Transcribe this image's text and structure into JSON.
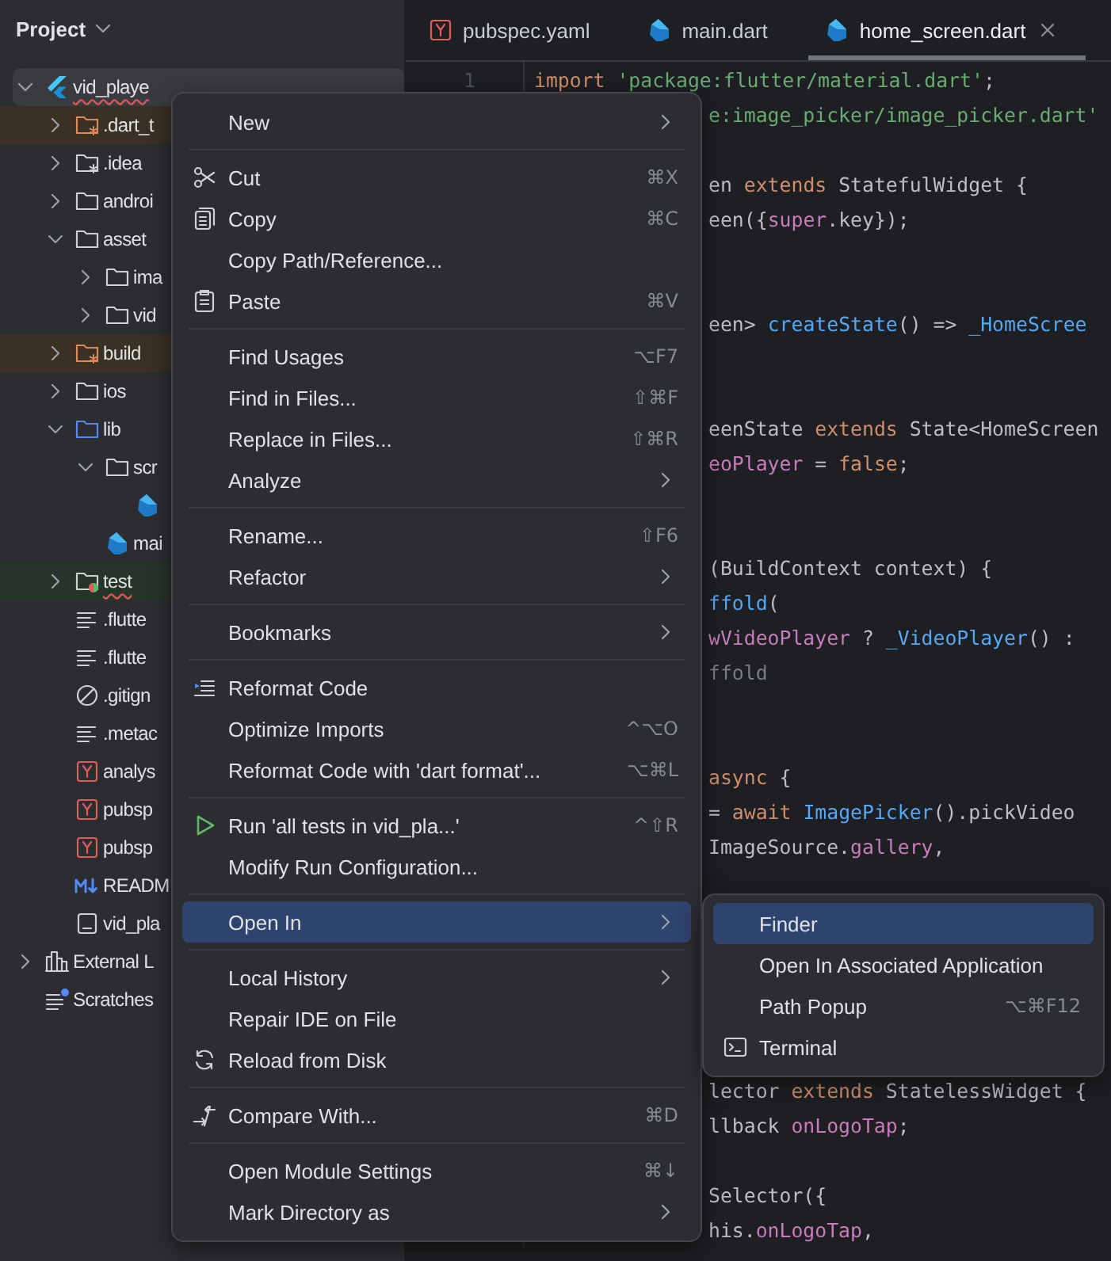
{
  "project_panel": {
    "title": "Project",
    "tree": [
      {
        "label": "vid_playe",
        "kind": "flutter",
        "expanded": true,
        "selected": true,
        "misspelled": true,
        "children": [
          {
            "label": ".dart_t",
            "kind": "folder-excluded",
            "expanded": false,
            "selected": false,
            "excluded": true
          },
          {
            "label": ".idea",
            "kind": "folder-config",
            "expanded": false,
            "selected": false
          },
          {
            "label": "androi",
            "kind": "folder",
            "expanded": false,
            "selected": false
          },
          {
            "label": "asset",
            "kind": "folder",
            "expanded": true,
            "selected": false,
            "children": [
              {
                "label": "ima",
                "kind": "folder",
                "expanded": false,
                "selected": false
              },
              {
                "label": "vid",
                "kind": "folder",
                "expanded": false,
                "selected": false
              }
            ]
          },
          {
            "label": "build",
            "kind": "folder-excluded",
            "expanded": false,
            "selected": false,
            "excluded": true
          },
          {
            "label": "ios",
            "kind": "folder",
            "expanded": false,
            "selected": false
          },
          {
            "label": "lib",
            "kind": "folder-source",
            "expanded": true,
            "selected": false,
            "children": [
              {
                "label": "scr",
                "kind": "folder",
                "expanded": true,
                "selected": false,
                "children": [
                  {
                    "kind": "dart",
                    "selected": false
                  }
                ]
              },
              {
                "label": "mai",
                "kind": "dart",
                "selected": false
              }
            ]
          },
          {
            "label": "test",
            "kind": "folder-test",
            "expanded": false,
            "selected": false,
            "test_root": true,
            "misspelled": true
          },
          {
            "label": ".flutte",
            "kind": "text",
            "selected": false
          },
          {
            "label": ".flutte",
            "kind": "text",
            "selected": false
          },
          {
            "label": ".gitign",
            "kind": "ignore",
            "selected": false
          },
          {
            "label": ".metac",
            "kind": "text",
            "selected": false
          },
          {
            "label": "analys",
            "kind": "yaml",
            "selected": false
          },
          {
            "label": "pubsp",
            "kind": "yaml",
            "selected": false
          },
          {
            "label": "pubsp",
            "kind": "yaml",
            "selected": false
          },
          {
            "label": "READM",
            "kind": "markdown",
            "selected": false
          },
          {
            "label": "vid_pla",
            "kind": "file",
            "selected": false
          }
        ]
      },
      {
        "label": "External L",
        "kind": "library",
        "expanded": false,
        "selected": false
      },
      {
        "label": "Scratches",
        "kind": "scratches",
        "selected": false
      }
    ]
  },
  "editor": {
    "tabs": [
      {
        "label": "pubspec.yaml",
        "kind": "yaml",
        "selected": false
      },
      {
        "label": "main.dart",
        "kind": "dart",
        "selected": false
      },
      {
        "label": "home_screen.dart",
        "kind": "dart",
        "selected": true
      }
    ],
    "lines": [
      {
        "kind": "full",
        "number": "1",
        "tokens": [
          {
            "text": "import ",
            "kind": "keyword"
          },
          {
            "text": "'package:flutter/material.dart'",
            "kind": "string"
          },
          {
            "text": ";",
            "kind": "plain"
          }
        ]
      },
      {
        "kind": "clipped",
        "tokens": [
          {
            "text": "e:image_picker/image_picker.dart'",
            "kind": "string"
          }
        ]
      },
      {
        "kind": "blank"
      },
      {
        "kind": "clipped",
        "tokens": [
          {
            "text": "en ",
            "kind": "plain"
          },
          {
            "text": "extends",
            "kind": "keyword"
          },
          {
            "text": " StatefulWidget {",
            "kind": "plain"
          }
        ]
      },
      {
        "kind": "clipped",
        "tokens": [
          {
            "text": "een({",
            "kind": "plain"
          },
          {
            "text": "super",
            "kind": "field"
          },
          {
            "text": ".key});",
            "kind": "plain"
          }
        ]
      },
      {
        "kind": "blank"
      },
      {
        "kind": "blank"
      },
      {
        "kind": "clipped",
        "tokens": [
          {
            "text": "een> ",
            "kind": "plain"
          },
          {
            "text": "createState",
            "kind": "function"
          },
          {
            "text": "() => ",
            "kind": "plain"
          },
          {
            "text": "_HomeScree",
            "kind": "function"
          }
        ]
      },
      {
        "kind": "blank"
      },
      {
        "kind": "blank"
      },
      {
        "kind": "clipped",
        "tokens": [
          {
            "text": "eenState ",
            "kind": "plain"
          },
          {
            "text": "extends",
            "kind": "keyword"
          },
          {
            "text": " State<HomeScreen",
            "kind": "plain"
          }
        ]
      },
      {
        "kind": "clipped",
        "tokens": [
          {
            "text": "eoPlayer",
            "kind": "field"
          },
          {
            "text": " = ",
            "kind": "plain"
          },
          {
            "text": "false",
            "kind": "keyword"
          },
          {
            "text": ";",
            "kind": "plain"
          }
        ]
      },
      {
        "kind": "blank"
      },
      {
        "kind": "blank"
      },
      {
        "kind": "clipped",
        "tokens": [
          {
            "text": "(BuildContext context) {",
            "kind": "plain"
          }
        ]
      },
      {
        "kind": "clipped",
        "tokens": [
          {
            "text": "ffold",
            "kind": "function"
          },
          {
            "text": "(",
            "kind": "plain"
          }
        ]
      },
      {
        "kind": "clipped",
        "tokens": [
          {
            "text": "wVideoPlayer",
            "kind": "field"
          },
          {
            "text": " ? ",
            "kind": "plain"
          },
          {
            "text": "_VideoPlayer",
            "kind": "function"
          },
          {
            "text": "() :",
            "kind": "plain"
          }
        ]
      },
      {
        "kind": "clipped",
        "tokens": [
          {
            "text": "ffold",
            "kind": "comment"
          }
        ]
      },
      {
        "kind": "blank"
      },
      {
        "kind": "blank"
      },
      {
        "kind": "clipped",
        "tokens": [
          {
            "text": "async",
            "kind": "keyword"
          },
          {
            "text": " {",
            "kind": "plain"
          }
        ]
      },
      {
        "kind": "clipped",
        "tokens": [
          {
            "text": "= ",
            "kind": "plain"
          },
          {
            "text": "await ",
            "kind": "keyword"
          },
          {
            "text": "ImagePicker",
            "kind": "function"
          },
          {
            "text": "().pickVideo",
            "kind": "plain"
          }
        ]
      },
      {
        "kind": "clipped",
        "tokens": [
          {
            "text": "ImageSource.",
            "kind": "plain"
          },
          {
            "text": "gallery",
            "kind": "field"
          },
          {
            "text": ",",
            "kind": "plain"
          }
        ]
      },
      {
        "kind": "blank"
      },
      {
        "kind": "blank"
      },
      {
        "kind": "blank"
      },
      {
        "kind": "blank"
      },
      {
        "kind": "blank"
      },
      {
        "kind": "blank"
      },
      {
        "kind": "clipped",
        "tokens": [
          {
            "text": "lector ",
            "kind": "plain"
          },
          {
            "text": "extends",
            "kind": "keyword"
          },
          {
            "text": " StatelessWidget {",
            "kind": "plain"
          }
        ]
      },
      {
        "kind": "clipped",
        "tokens": [
          {
            "text": "llback ",
            "kind": "plain"
          },
          {
            "text": "onLogoTap",
            "kind": "field"
          },
          {
            "text": ";",
            "kind": "plain"
          }
        ]
      },
      {
        "kind": "blank"
      },
      {
        "kind": "clipped",
        "tokens": [
          {
            "text": "Selector({",
            "kind": "plain"
          }
        ]
      },
      {
        "kind": "clipped",
        "tokens": [
          {
            "text": "his.",
            "kind": "plain"
          },
          {
            "text": "onLogoTap",
            "kind": "field"
          },
          {
            "text": ",",
            "kind": "plain"
          }
        ]
      }
    ]
  },
  "context_menu": {
    "groups": [
      [
        {
          "label": "New",
          "submenu": true,
          "selected": false
        }
      ],
      [
        {
          "label": "Cut",
          "kind": "cut",
          "shortcut": "⌘X",
          "submenu": false,
          "selected": false
        },
        {
          "label": "Copy",
          "kind": "copy",
          "shortcut": "⌘C",
          "submenu": false,
          "selected": false
        },
        {
          "label": "Copy Path/Reference...",
          "submenu": false,
          "selected": false
        },
        {
          "label": "Paste",
          "kind": "paste",
          "shortcut": "⌘V",
          "submenu": false,
          "selected": false
        }
      ],
      [
        {
          "label": "Find Usages",
          "shortcut": "⌥F7",
          "submenu": false,
          "selected": false
        },
        {
          "label": "Find in Files...",
          "shortcut": "⇧⌘F",
          "submenu": false,
          "selected": false
        },
        {
          "label": "Replace in Files...",
          "shortcut": "⇧⌘R",
          "submenu": false,
          "selected": false
        },
        {
          "label": "Analyze",
          "submenu": true,
          "selected": false
        }
      ],
      [
        {
          "label": "Rename...",
          "shortcut": "⇧F6",
          "submenu": false,
          "selected": false
        },
        {
          "label": "Refactor",
          "submenu": true,
          "selected": false
        }
      ],
      [
        {
          "label": "Bookmarks",
          "submenu": true,
          "selected": false
        }
      ],
      [
        {
          "label": "Reformat Code",
          "kind": "reformat",
          "submenu": false,
          "selected": false
        },
        {
          "label": "Optimize Imports",
          "shortcut": "^⌥O",
          "submenu": false,
          "selected": false
        },
        {
          "label": "Reformat Code with 'dart format'...",
          "shortcut": "⌥⌘L",
          "submenu": false,
          "selected": false
        }
      ],
      [
        {
          "label": "Run 'all tests in vid_pla...'",
          "kind": "run",
          "shortcut": "^⇧R",
          "submenu": false,
          "selected": false
        },
        {
          "label": "Modify Run Configuration...",
          "submenu": false,
          "selected": false
        }
      ],
      [
        {
          "label": "Open In",
          "submenu": true,
          "selected": true
        }
      ],
      [
        {
          "label": "Local History",
          "submenu": true,
          "selected": false
        },
        {
          "label": "Repair IDE on File",
          "submenu": false,
          "selected": false
        },
        {
          "label": "Reload from Disk",
          "kind": "reload",
          "submenu": false,
          "selected": false
        }
      ],
      [
        {
          "label": "Compare With...",
          "kind": "compare",
          "shortcut": "⌘D",
          "submenu": false,
          "selected": false
        }
      ],
      [
        {
          "label": "Open Module Settings",
          "shortcut": "⌘↓",
          "submenu": false,
          "selected": false
        },
        {
          "label": "Mark Directory as",
          "submenu": true,
          "selected": false
        }
      ]
    ]
  },
  "submenu": {
    "items": [
      {
        "label": "Finder",
        "selected": true
      },
      {
        "label": "Open In Associated Application",
        "selected": false
      },
      {
        "label": "Path Popup",
        "shortcut": "⌥⌘F12",
        "selected": false
      },
      {
        "label": "Terminal",
        "kind": "terminal",
        "selected": false
      }
    ]
  }
}
